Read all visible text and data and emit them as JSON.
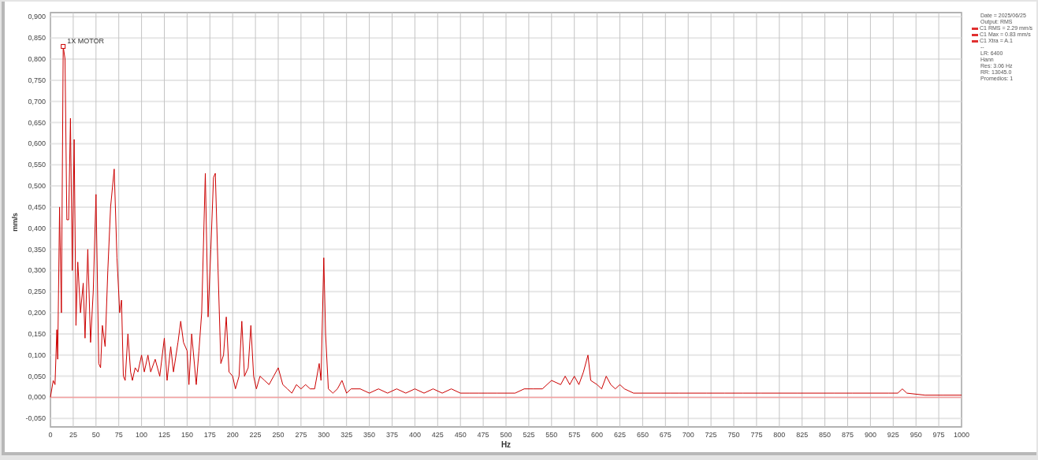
{
  "chart": {
    "chart_data": {
      "type": "line",
      "xlabel": "Hz",
      "ylabel": "mm/s",
      "xlim": [
        0,
        1000
      ],
      "ylim": [
        -0.07,
        0.91
      ],
      "xticks": [
        0,
        25,
        50,
        75,
        100,
        125,
        150,
        175,
        200,
        225,
        250,
        275,
        300,
        325,
        350,
        375,
        400,
        425,
        450,
        475,
        500,
        525,
        550,
        575,
        600,
        625,
        650,
        675,
        700,
        725,
        750,
        775,
        800,
        825,
        850,
        875,
        900,
        925,
        950,
        975,
        1000
      ],
      "yticks": [
        {
          "value": 0.9,
          "label": "0,900"
        },
        {
          "value": 0.85,
          "label": "0,850"
        },
        {
          "value": 0.8,
          "label": "0,800"
        },
        {
          "value": 0.75,
          "label": "0,750"
        },
        {
          "value": 0.7,
          "label": "0,700"
        },
        {
          "value": 0.65,
          "label": "0,650"
        },
        {
          "value": 0.6,
          "label": "0,600"
        },
        {
          "value": 0.55,
          "label": "0,550"
        },
        {
          "value": 0.5,
          "label": "0,500"
        },
        {
          "value": 0.45,
          "label": "0,450"
        },
        {
          "value": 0.4,
          "label": "0,400"
        },
        {
          "value": 0.35,
          "label": "0,350"
        },
        {
          "value": 0.3,
          "label": "0,300"
        },
        {
          "value": 0.25,
          "label": "0,250"
        },
        {
          "value": 0.2,
          "label": "0,200"
        },
        {
          "value": 0.15,
          "label": "0,150"
        },
        {
          "value": 0.1,
          "label": "0,100"
        },
        {
          "value": 0.05,
          "label": "0,050"
        },
        {
          "value": 0,
          "label": "0,000"
        },
        {
          "value": -0.05,
          "label": "-0,050"
        }
      ],
      "x": [
        0,
        3,
        5,
        7,
        8,
        10,
        12,
        14,
        16,
        18,
        20,
        22,
        24,
        26,
        28,
        30,
        33,
        36,
        38,
        41,
        44,
        47,
        50,
        53,
        55,
        57,
        60,
        63,
        66,
        70,
        73,
        76,
        78,
        80,
        82,
        85,
        88,
        90,
        93,
        96,
        100,
        103,
        107,
        110,
        115,
        120,
        125,
        128,
        132,
        135,
        140,
        143,
        146,
        150,
        152,
        155,
        160,
        163,
        166,
        170,
        173,
        176,
        179,
        181,
        184,
        187,
        190,
        193,
        196,
        200,
        203,
        207,
        210,
        213,
        217,
        220,
        223,
        226,
        230,
        235,
        240,
        245,
        250,
        255,
        260,
        265,
        270,
        275,
        280,
        285,
        290,
        295,
        297,
        300,
        302,
        305,
        310,
        315,
        320,
        325,
        330,
        340,
        350,
        360,
        370,
        380,
        390,
        400,
        410,
        420,
        430,
        440,
        450,
        460,
        470,
        480,
        490,
        500,
        510,
        520,
        530,
        540,
        550,
        560,
        565,
        570,
        575,
        580,
        585,
        590,
        593,
        600,
        605,
        610,
        615,
        620,
        625,
        630,
        640,
        650,
        660,
        670,
        680,
        690,
        700,
        720,
        740,
        760,
        780,
        800,
        820,
        840,
        860,
        880,
        900,
        920,
        930,
        935,
        940,
        960,
        980,
        1000
      ],
      "series": [
        {
          "color": "#cc0000",
          "values": [
            0,
            0.04,
            0.03,
            0.16,
            0.09,
            0.45,
            0.2,
            0.83,
            0.8,
            0.42,
            0.42,
            0.66,
            0.3,
            0.61,
            0.17,
            0.32,
            0.2,
            0.27,
            0.14,
            0.35,
            0.13,
            0.25,
            0.48,
            0.08,
            0.07,
            0.17,
            0.12,
            0.3,
            0.45,
            0.54,
            0.33,
            0.2,
            0.23,
            0.05,
            0.04,
            0.15,
            0.06,
            0.04,
            0.07,
            0.06,
            0.1,
            0.06,
            0.1,
            0.06,
            0.09,
            0.05,
            0.14,
            0.04,
            0.12,
            0.06,
            0.13,
            0.18,
            0.13,
            0.11,
            0.03,
            0.15,
            0.03,
            0.11,
            0.2,
            0.53,
            0.19,
            0.35,
            0.52,
            0.53,
            0.3,
            0.08,
            0.1,
            0.19,
            0.06,
            0.05,
            0.02,
            0.05,
            0.18,
            0.05,
            0.07,
            0.17,
            0.05,
            0.02,
            0.05,
            0.04,
            0.03,
            0.05,
            0.07,
            0.03,
            0.02,
            0.01,
            0.03,
            0.02,
            0.03,
            0.02,
            0.02,
            0.08,
            0.04,
            0.33,
            0.15,
            0.02,
            0.01,
            0.02,
            0.04,
            0.01,
            0.02,
            0.02,
            0.01,
            0.02,
            0.01,
            0.02,
            0.01,
            0.02,
            0.01,
            0.02,
            0.01,
            0.02,
            0.01,
            0.01,
            0.01,
            0.01,
            0.01,
            0.01,
            0.01,
            0.02,
            0.02,
            0.02,
            0.04,
            0.03,
            0.05,
            0.03,
            0.05,
            0.03,
            0.06,
            0.1,
            0.04,
            0.03,
            0.02,
            0.05,
            0.03,
            0.02,
            0.03,
            0.02,
            0.01,
            0.01,
            0.01,
            0.01,
            0.01,
            0.01,
            0.01,
            0.01,
            0.01,
            0.01,
            0.01,
            0.01,
            0.01,
            0.01,
            0.01,
            0.01,
            0.01,
            0.01,
            0.01,
            0.02,
            0.01,
            0.005,
            0.005,
            0.005
          ]
        }
      ],
      "grid": true,
      "ref_lines": [
        {
          "axis": "y",
          "value": 0,
          "color": "#f4a0a0"
        }
      ],
      "annotations": [
        {
          "x": 14,
          "y": 0.83,
          "text": "1X MOTOR"
        }
      ]
    }
  },
  "legend": [
    {
      "kind": "text",
      "label": "Date = 2025/06/25"
    },
    {
      "kind": "text",
      "label": "Output: RMS"
    },
    {
      "kind": "series",
      "label": "C1 RMS = 2.29 mm/s",
      "color": "#e03030"
    },
    {
      "kind": "series",
      "label": "C1 Max = 0.83 mm/s",
      "color": "#e03030"
    },
    {
      "kind": "series",
      "label": "C1 Xtra = A.1",
      "color": "#e03030"
    },
    {
      "kind": "text",
      "label": "--"
    },
    {
      "kind": "text",
      "label": "LR: 6400"
    },
    {
      "kind": "text",
      "label": "Hann"
    },
    {
      "kind": "text",
      "label": "Res: 3.06 Hz"
    },
    {
      "kind": "text",
      "label": "RR: 13045.0"
    },
    {
      "kind": "text",
      "label": "Promedios: 1"
    }
  ]
}
